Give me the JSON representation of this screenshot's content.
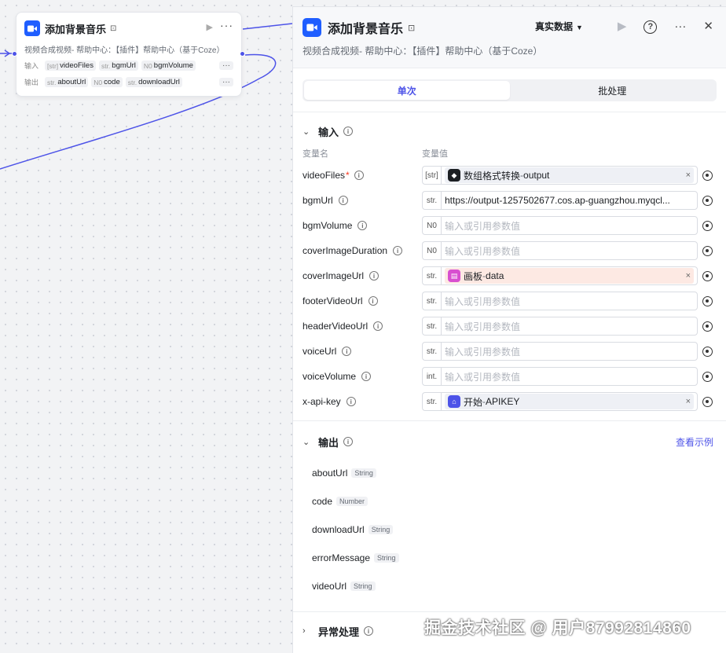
{
  "node": {
    "title": "添加背景音乐",
    "desc": "视频合成视频- 帮助中心：【插件】帮助中心（基于Coze）",
    "input_label": "输入",
    "output_label": "输出",
    "inputs": [
      {
        "type": "[str]",
        "name": "videoFiles"
      },
      {
        "type": "str.",
        "name": "bgmUrl"
      },
      {
        "type": "N0",
        "name": "bgmVolume"
      }
    ],
    "outputs": [
      {
        "type": "str.",
        "name": "aboutUrl"
      },
      {
        "type": "N0",
        "name": "code"
      },
      {
        "type": "str.",
        "name": "downloadUrl"
      }
    ],
    "more_chip": "···"
  },
  "panel": {
    "title": "添加背景音乐",
    "desc": "视频合成视频- 帮助中心：【插件】帮助中心（基于Coze）",
    "data_mode": "真实数据",
    "tabs": {
      "single": "单次",
      "batch": "批处理"
    },
    "input_section": "输入",
    "col_name": "变量名",
    "col_value": "变量值",
    "placeholder": "输入或引用参数值",
    "params": [
      {
        "name": "videoFiles",
        "required": "*",
        "type": "[str]",
        "kind": "ref",
        "ref_node": "数组格式转换",
        "ref_var": "output",
        "ref_sep": " - ",
        "icon": "plugin-icon",
        "color": "#eef0f5"
      },
      {
        "name": "bgmUrl",
        "required": "",
        "type": "str.",
        "kind": "value",
        "value": "https://output-1257502677.cos.ap-guangzhou.myqcl..."
      },
      {
        "name": "bgmVolume",
        "required": "",
        "type": "N0",
        "kind": "empty"
      },
      {
        "name": "coverImageDuration",
        "required": "",
        "type": "N0",
        "kind": "empty"
      },
      {
        "name": "coverImageUrl",
        "required": "",
        "type": "str.",
        "kind": "ref",
        "ref_node": "画板",
        "ref_var": "data",
        "ref_sep": " - ",
        "icon": "canvas-icon",
        "color": "#fde9e3"
      },
      {
        "name": "footerVideoUrl",
        "required": "",
        "type": "str.",
        "kind": "empty"
      },
      {
        "name": "headerVideoUrl",
        "required": "",
        "type": "str.",
        "kind": "empty"
      },
      {
        "name": "voiceUrl",
        "required": "",
        "type": "str.",
        "kind": "empty"
      },
      {
        "name": "voiceVolume",
        "required": "",
        "type": "int.",
        "kind": "empty"
      },
      {
        "name": "x-api-key",
        "required": "",
        "type": "str.",
        "kind": "ref",
        "ref_node": "开始",
        "ref_var": "APIKEY",
        "ref_sep": " - ",
        "icon": "start-icon",
        "color": "#eef0f5"
      }
    ],
    "output_section": "输出",
    "see_example": "查看示例",
    "outputs": [
      {
        "name": "aboutUrl",
        "type": "String"
      },
      {
        "name": "code",
        "type": "Number"
      },
      {
        "name": "downloadUrl",
        "type": "String"
      },
      {
        "name": "errorMessage",
        "type": "String"
      },
      {
        "name": "videoUrl",
        "type": "String"
      }
    ],
    "error_section": "异常处理"
  },
  "watermark": "掘金技术社区 @ 用户87992814860",
  "colors": {
    "accent": "#4d53e8",
    "brand": "#1f5eff",
    "required": "#f93920"
  }
}
